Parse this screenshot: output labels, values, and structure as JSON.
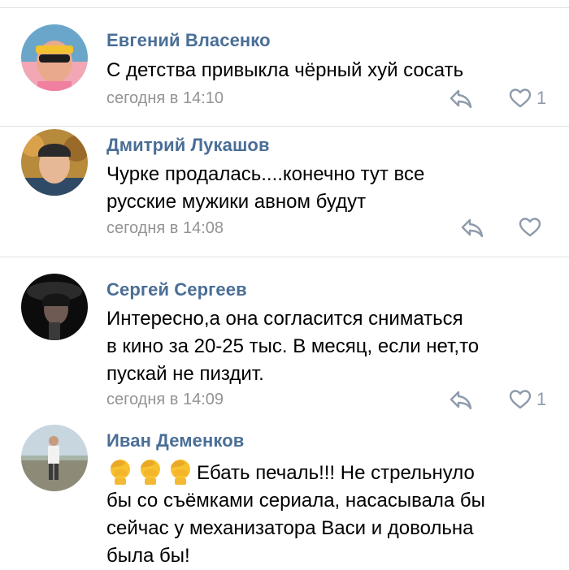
{
  "comments": [
    {
      "author": "Евгений Власенко",
      "lines": [
        "С детства привыкла чёрный хуй сосать"
      ],
      "time": "сегодня в 14:10",
      "likes": "1"
    },
    {
      "author": "Дмитрий Лукашов",
      "lines": [
        "Чурке продалась....конечно тут все",
        "русские мужики авном будут"
      ],
      "time": "сегодня в 14:08",
      "likes": ""
    },
    {
      "author": "Сергей Сергеев",
      "lines": [
        "Интересно,а она согласится сниматься",
        "в кино за 20-25 тыс. В месяц, если нет,то",
        "пускай не пиздит."
      ],
      "time": "сегодня в 14:09",
      "likes": "1"
    },
    {
      "author": "Иван Деменков",
      "lines": [
        "Ебать печаль!!! Не стрельнуло",
        "бы со съёмками сериала, насасывала бы",
        "сейчас у механизатора Васи и довольна",
        "была бы!"
      ],
      "emoji": [
        "facepalm-emoji",
        "facepalm-emoji",
        "facepalm-emoji"
      ],
      "time": "",
      "likes": ""
    }
  ],
  "icons": {
    "reply": "reply-icon",
    "like": "heart-outline-icon"
  },
  "colors": {
    "author": "#4a6e96",
    "meta": "#939393",
    "action": "#8e9bab",
    "divider": "#e1e3e6"
  }
}
